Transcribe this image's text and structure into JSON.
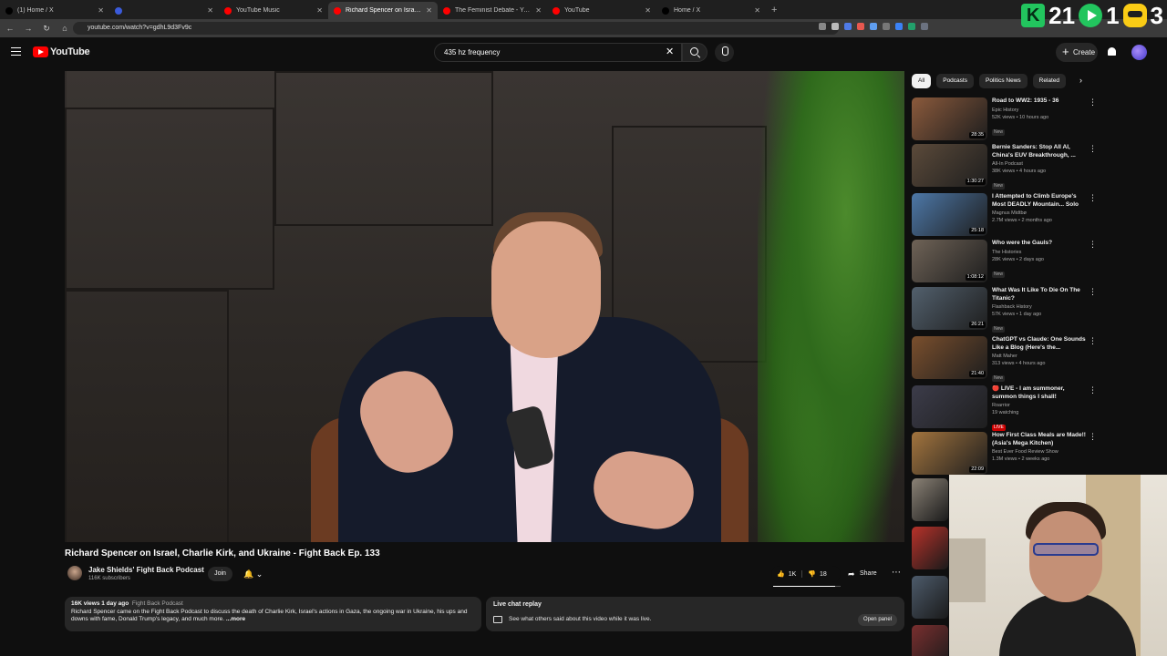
{
  "browser": {
    "tabs": [
      {
        "title": "(1) Home / X",
        "favicon_color": "#000000",
        "active": false
      },
      {
        "title": "",
        "favicon_color": "#3b5bdb",
        "active": false
      },
      {
        "title": "YouTube Music",
        "favicon_color": "#ff0000",
        "active": false
      },
      {
        "title": "Richard Spencer on Israel, C",
        "favicon_color": "#ff0000",
        "active": true
      },
      {
        "title": "The Feminist Debate - YouTube",
        "favicon_color": "#ff0000",
        "active": false
      },
      {
        "title": "YouTube",
        "favicon_color": "#ff0000",
        "active": false
      },
      {
        "title": "Home / X",
        "favicon_color": "#000000",
        "active": false
      }
    ],
    "url": "youtube.com/watch?v=gdhL9d3Fv9c"
  },
  "stream_overlay": {
    "count_a": "21",
    "count_b": "1",
    "count_c": "3"
  },
  "youtube": {
    "logo_text": "YouTube",
    "search_value": "435 hz frequency",
    "create_label": "Create"
  },
  "video": {
    "title": "Richard Spencer on Israel, Charlie Kirk, and Ukraine - Fight Back Ep. 133",
    "channel": "Jake Shields' Fight Back Podcast",
    "subscribers": "116K subscribers",
    "join_label": "Join",
    "likes": "1K",
    "dislikes": "18",
    "share_label": "Share",
    "like_ratio": 0.92,
    "description": {
      "meta": "16K views  1 day ago",
      "hashtag": "Fight Back Podcast",
      "text": "Richard Spencer came on the Fight Back Podcast to discuss the death of Charlie Kirk, Israel's actions in Gaza, the ongoing war in Ukraine, his ups and downs with fame, Donald Trump's legacy, and much more.",
      "more_label": "...more"
    },
    "live_chat": {
      "title": "Live chat replay",
      "text": "See what others said about this video while it was live.",
      "button": "Open panel"
    }
  },
  "sidebar": {
    "chips": [
      "All",
      "Podcasts",
      "Politics News",
      "Related"
    ],
    "recommendations": [
      {
        "title": "Road to WW2: 1935 - 36",
        "channel": "Epic History",
        "stats": "52K views • 10 hours ago",
        "badge": "New",
        "duration": "28:35",
        "thumb": "#8b5a3c"
      },
      {
        "title": "Bernie Sanders: Stop All AI, China's EUV Breakthrough, ...",
        "channel": "All-In Podcast",
        "stats": "38K views • 4 hours ago",
        "badge": "New",
        "duration": "1:30:27",
        "thumb": "#5b4a3a"
      },
      {
        "title": "I Attempted to Climb Europe's Most DEADLY Mountain... Solo",
        "channel": "Magnus Midtbø",
        "stats": "2.7M views • 2 months ago",
        "badge": "",
        "duration": "25:18",
        "thumb": "#4d78a8"
      },
      {
        "title": "Who were the Gauls?",
        "channel": "The Histories",
        "stats": "28K views • 2 days ago",
        "badge": "New",
        "duration": "1:08:12",
        "thumb": "#6f6357"
      },
      {
        "title": "What Was It Like To Die On The Titanic?",
        "channel": "Flashback History",
        "stats": "57K views • 1 day ago",
        "badge": "New",
        "duration": "26:21",
        "thumb": "#52606d"
      },
      {
        "title": "ChatGPT vs Claude: One Sounds Like a Blog (Here's the...",
        "channel": "Matt Maher",
        "stats": "313 views • 4 hours ago",
        "badge": "New",
        "duration": "21:40",
        "thumb": "#7a4f2d"
      },
      {
        "title": "🔴 LIVE - I am summoner, summon things I shall!",
        "channel": "Roarrior",
        "stats": "19 watching",
        "badge": "LIVE",
        "duration": "",
        "thumb": "#3c3c4a"
      },
      {
        "title": "How First Class Meals are Made!! (Asia's Mega Kitchen)",
        "channel": "Best Ever Food Review Show",
        "stats": "1.3M views • 2 weeks ago",
        "badge": "",
        "duration": "22:09",
        "thumb": "#a2743e"
      }
    ],
    "partial_thumbs": [
      "#8b8276",
      "#b8322a",
      "#4d5b6b",
      "#7a2f2f"
    ]
  }
}
